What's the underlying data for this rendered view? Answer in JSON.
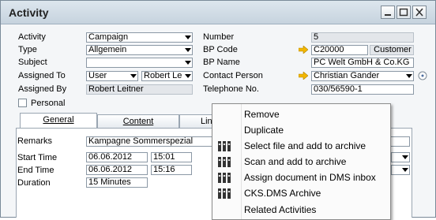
{
  "window": {
    "title": "Activity"
  },
  "left": {
    "activity_label": "Activity",
    "activity_value": "Campaign",
    "type_label": "Type",
    "type_value": "Allgemein",
    "subject_label": "Subject",
    "subject_value": "",
    "assigned_to_label": "Assigned To",
    "assigned_to_kind": "User",
    "assigned_to_user": "Robert Leitner",
    "assigned_by_label": "Assigned By",
    "assigned_by_value": "Robert Leitner",
    "personal_label": "Personal"
  },
  "right": {
    "number_label": "Number",
    "number_value": "5",
    "bp_code_label": "BP Code",
    "bp_code_value": "C20000",
    "bp_code_type": "Customer",
    "bp_name_label": "BP Name",
    "bp_name_value": "PC Welt GmbH & Co.KG",
    "contact_label": "Contact Person",
    "contact_value": "Christian Gander",
    "phone_label": "Telephone No.",
    "phone_value": "030/56590-1"
  },
  "tabs": [
    {
      "label": "General"
    },
    {
      "label": "Content"
    },
    {
      "label": "Lin"
    }
  ],
  "general": {
    "remarks_label": "Remarks",
    "remarks_value": "Kampagne Sommerspezial",
    "start_label": "Start Time",
    "start_date": "06.06.2012",
    "start_time": "15:01",
    "end_label": "End Time",
    "end_date": "06.06.2012",
    "end_time": "15:16",
    "duration_label": "Duration",
    "duration_value": "15 Minutes"
  },
  "context_menu": {
    "items": [
      {
        "label": "Remove",
        "icon": ""
      },
      {
        "label": "Duplicate",
        "icon": ""
      },
      {
        "label": "Select file and add to archive",
        "icon": "archive-binder-icon"
      },
      {
        "label": "Scan and add to archive",
        "icon": "archive-binder-icon"
      },
      {
        "label": "Assign document in DMS inbox",
        "icon": "archive-binder-icon"
      },
      {
        "label": "CKS.DMS Archive",
        "icon": "archive-binder-icon"
      },
      {
        "label": "Related Activities",
        "icon": ""
      }
    ]
  },
  "colors": {
    "link_arrow": "#f2b600",
    "titlebar": "#c6d3de"
  }
}
